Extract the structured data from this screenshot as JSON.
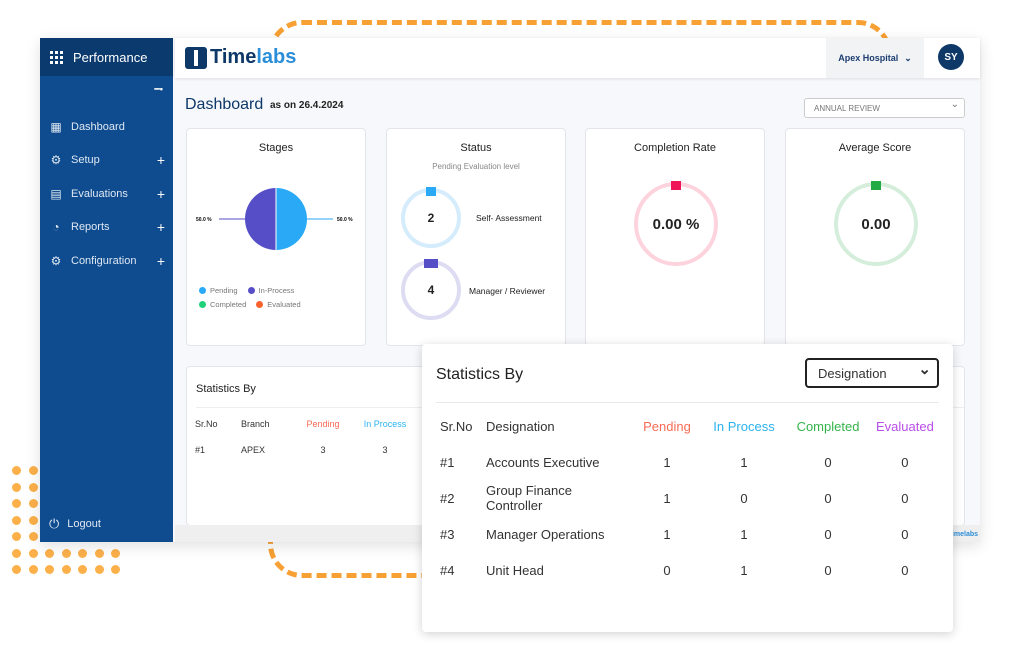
{
  "sidebar": {
    "title": "Performance",
    "items": [
      {
        "label": "Dashboard",
        "icon": "dashboard-icon"
      },
      {
        "label": "Setup",
        "icon": "setup-icon",
        "expand": "+"
      },
      {
        "label": "Evaluations",
        "icon": "evaluations-icon",
        "expand": "+"
      },
      {
        "label": "Reports",
        "icon": "reports-icon",
        "expand": "+"
      },
      {
        "label": "Configuration",
        "icon": "gear-icon",
        "expand": "+"
      }
    ],
    "logout": "Logout"
  },
  "header": {
    "logo_a": "Time",
    "logo_b": "labs",
    "org": "Apex Hospital",
    "avatar": "SY"
  },
  "page": {
    "title": "Dashboard",
    "as_on": "as on 26.4.2024",
    "review_select": "ANNUAL REVIEW"
  },
  "stages": {
    "title": "Stages",
    "left_label": "50.0 %",
    "right_label": "50.0 %",
    "legend": [
      "Pending",
      "In-Process",
      "Completed",
      "Evaluated"
    ],
    "colors": [
      "#29a9f6",
      "#564ec6",
      "#1fd17a",
      "#f8622f"
    ]
  },
  "status": {
    "title": "Status",
    "subtitle": "Pending Evaluation level",
    "items": [
      {
        "value": "2",
        "label": "Self- Assessment"
      },
      {
        "value": "4",
        "label": "Manager / Reviewer"
      }
    ]
  },
  "completion": {
    "title": "Completion Rate",
    "value": "0.00 %"
  },
  "average": {
    "title": "Average Score",
    "value": "0.00"
  },
  "stats_bg": {
    "title": "Statistics By",
    "headers": [
      "Sr.No",
      "Branch",
      "Pending",
      "In Process"
    ],
    "rows": [
      [
        "#1",
        "APEX",
        "3",
        "3"
      ]
    ]
  },
  "footer": {
    "logo": "Timelabs"
  },
  "popup": {
    "title": "Statistics By",
    "select": "Designation",
    "headers": [
      "Sr.No",
      "Designation",
      "Pending",
      "In Process",
      "Completed",
      "Evaluated"
    ],
    "header_colors": [
      "#333333",
      "#333333",
      "#f86b55",
      "#2bb3ee",
      "#34b34a",
      "#b84ee8"
    ],
    "rows": [
      [
        "#1",
        "Accounts Executive",
        "1",
        "1",
        "0",
        "0"
      ],
      [
        "#2",
        "Group Finance Controller",
        "1",
        "0",
        "0",
        "0"
      ],
      [
        "#3",
        "Manager Operations",
        "1",
        "1",
        "0",
        "0"
      ],
      [
        "#4",
        "Unit Head",
        "0",
        "1",
        "0",
        "0"
      ]
    ]
  }
}
